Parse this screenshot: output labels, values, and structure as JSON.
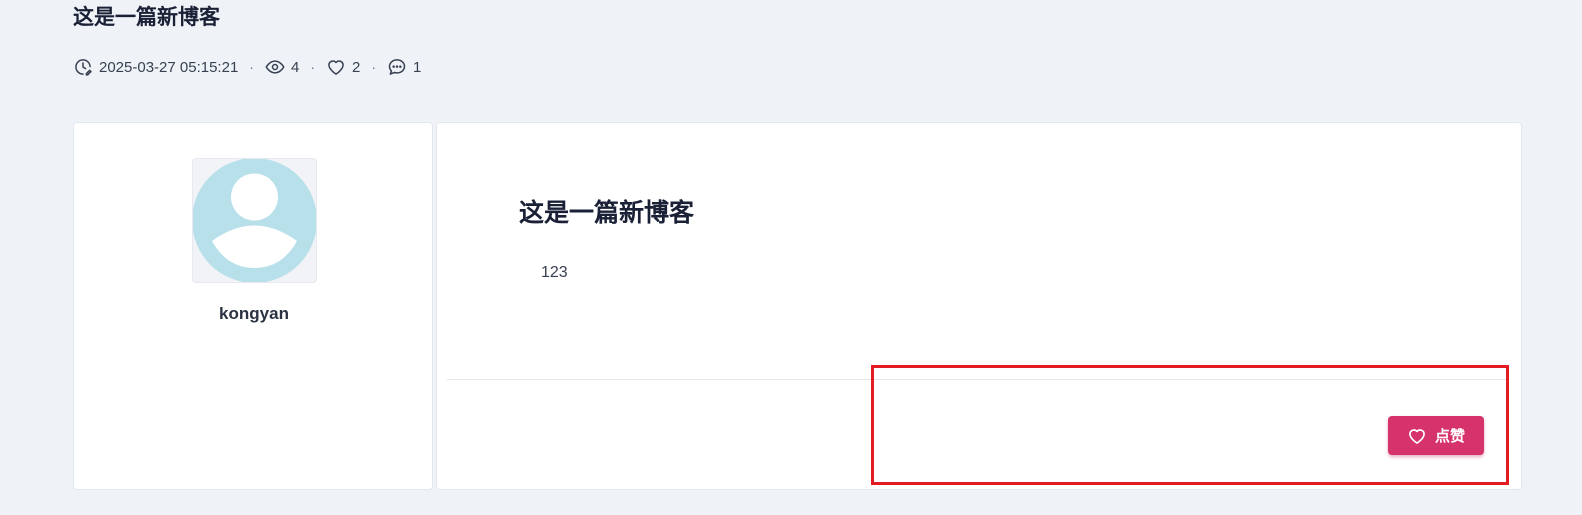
{
  "header": {
    "title": "这是一篇新博客",
    "timestamp": "2025-03-27 05:15:21",
    "views": "4",
    "likes": "2",
    "comments": "1",
    "separator": "·"
  },
  "author": {
    "name": "kongyan",
    "avatar_icon": "default-user-avatar-icon"
  },
  "article": {
    "title": "这是一篇新博客",
    "body": "123",
    "like_button_label": "点赞"
  },
  "colors": {
    "background": "#eff3f8",
    "like_button": "#d6336c",
    "avatar_tint": "#b8e0ea",
    "highlight": "#e31b23"
  }
}
